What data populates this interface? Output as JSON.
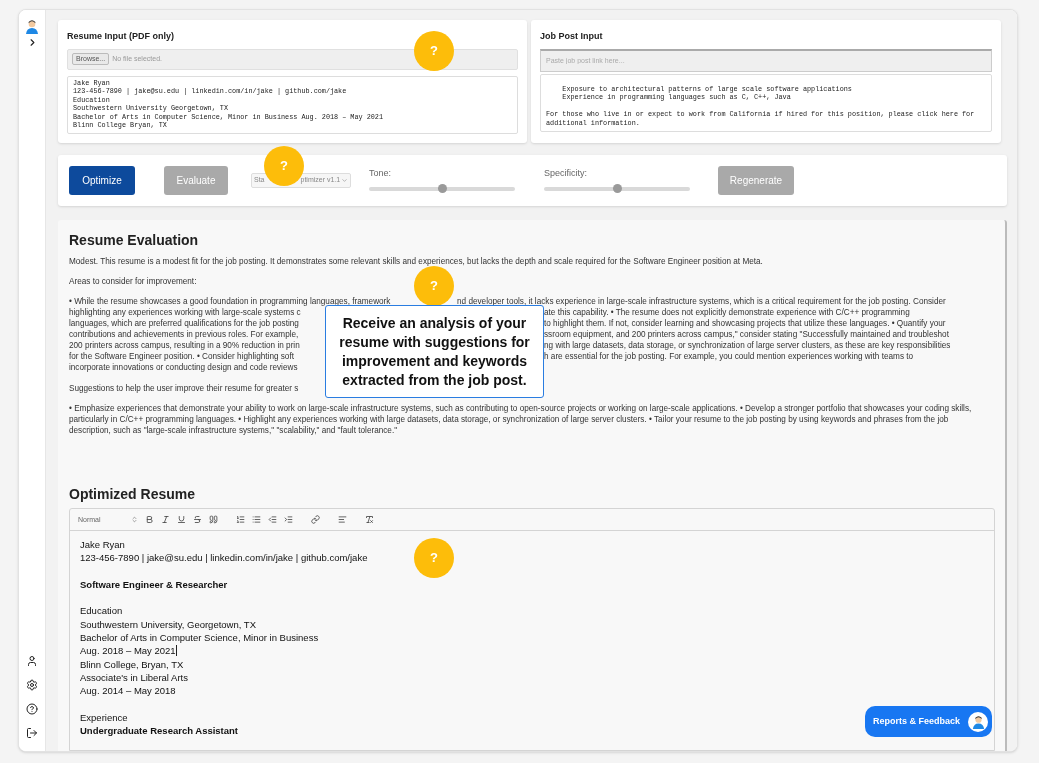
{
  "resume_input": {
    "title": "Resume Input (PDF only)",
    "browse_button": "Browse...",
    "file_status": "No file selected.",
    "text_lines": [
      "Jake Ryan",
      "123-456-7890 | jake@su.edu | linkedin.com/in/jake | github.com/jake",
      "Education",
      "Southwestern University Georgetown, TX",
      "Bachelor of Arts in Computer Science, Minor in Business Aug. 2018 – May 2021",
      "Blinn College Bryan, TX"
    ]
  },
  "job_post_input": {
    "title": "Job Post Input",
    "link_placeholder": "Paste job post link here...",
    "text_blocks": [
      [
        "    Exposure to architectural patterns of large scale software applications",
        "    Experience in programming languages such as C, C++, Java"
      ],
      [
        "For those who live in or expect to work from California if hired for this position, please click here for",
        "additional information."
      ]
    ]
  },
  "controls": {
    "optimize_button": {
      "label": "Optimize",
      "disabled": false
    },
    "evaluate_button": {
      "label": "Evaluate",
      "disabled": true
    },
    "model_select": {
      "visible_parts": [
        "Sta",
        "ptimizer v1.1"
      ],
      "disabled": true
    },
    "sliders": [
      {
        "label": "Tone:",
        "level": 0.5
      },
      {
        "label": "Specificity:",
        "level": 0.5
      }
    ],
    "regenerate_button": {
      "label": "Regenerate",
      "disabled": true
    }
  },
  "evaluation": {
    "title": "Resume Evaluation",
    "summary": "Modest. This resume is a modest fit for the job posting. It demonstrates some relevant skills and experiences, but lacks the depth and scale required for the Software Engineer position at Meta.",
    "areas_heading": "Areas to consider for improvement:",
    "areas_lines": [
      {
        "left": "• While the resume showcases a good foundation in programming languages, framework",
        "right": "nd developer tools, it lacks experience in large-scale infrastructure systems, which is a critical requirement for the job posting. Consider"
      },
      {
        "left": "highlighting any experiences working with large-scale systems c",
        "right": "ate this capability. • The resume does not explicitly demonstrate experience with C/C++ programming"
      },
      {
        "left": "languages, which are preferred qualifications for the job posting",
        "right": "to highlight them. If not, consider learning and showcasing projects that utilize these languages. • Quantify your"
      },
      {
        "left": "contributions and achievements in previous roles. For example,",
        "right": "ssroom equipment, and 200 printers across campus,\" consider stating \"Successfully maintained and troubleshot"
      },
      {
        "left": "200 printers across campus, resulting in a 90% reduction in prin",
        "right": "ng with large datasets, data storage, or synchronization of large server clusters, as these are key responsibilities"
      },
      {
        "left": "for the Software Engineer position. • Consider highlighting soft",
        "right": "h are essential for the job posting. For example, you could mention experiences working with teams to"
      },
      {
        "left": "incorporate innovations or conducting design and code reviews"
      }
    ],
    "suggestions_heading": "Suggestions to help the user improve their resume for greater s",
    "suggestions": "• Emphasize experiences that demonstrate your ability to work on large-scale infrastructure systems, such as contributing to open-source projects or working on large-scale applications. • Develop a stronger portfolio that showcases your coding skills, particularly in C/C++ programming languages. • Highlight any experiences working with large datasets, data storage, or synchronization of large server clusters. • Tailor your resume to the job posting by using keywords and phrases from the job description, such as \"large-scale infrastructure systems,\" \"scalability,\" and \"fault tolerance.\""
  },
  "optimized_resume": {
    "title": "Optimized Resume",
    "format_select": "Normal",
    "blocks": [
      [
        {
          "text": "Jake Ryan",
          "bold": false,
          "cursor": false
        },
        {
          "text": "123-456-7890 | jake@su.edu | linkedin.com/in/jake | github.com/jake",
          "bold": false,
          "cursor": false
        }
      ],
      [
        {
          "text": "Software Engineer & Researcher",
          "bold": true,
          "cursor": false
        }
      ],
      [
        {
          "text": "Education",
          "bold": false,
          "cursor": false
        },
        {
          "text": "Southwestern University, Georgetown, TX",
          "bold": false,
          "cursor": false
        },
        {
          "text": "Bachelor of Arts in Computer Science, Minor in Business",
          "bold": false,
          "cursor": false
        },
        {
          "text": "Aug. 2018 – May 2021",
          "bold": false,
          "cursor": true
        },
        {
          "text": "Blinn College, Bryan, TX",
          "bold": false,
          "cursor": false
        },
        {
          "text": "Associate's in Liberal Arts",
          "bold": false,
          "cursor": false
        },
        {
          "text": "Aug. 2014 – May 2018",
          "bold": false,
          "cursor": false
        }
      ],
      [
        {
          "text": "Experience",
          "bold": false,
          "cursor": false
        },
        {
          "text": "Undergraduate Research Assistant",
          "bold": true,
          "cursor": false
        }
      ]
    ]
  },
  "help_markers": [
    {
      "label": "?"
    },
    {
      "label": "?"
    },
    {
      "label": "?"
    },
    {
      "label": "?"
    }
  ],
  "tooltip": "Receive an analysis of your resume with suggestions for improvement and keywords extracted from the job post.",
  "feedback_button": {
    "label": "Reports & Feedback"
  }
}
